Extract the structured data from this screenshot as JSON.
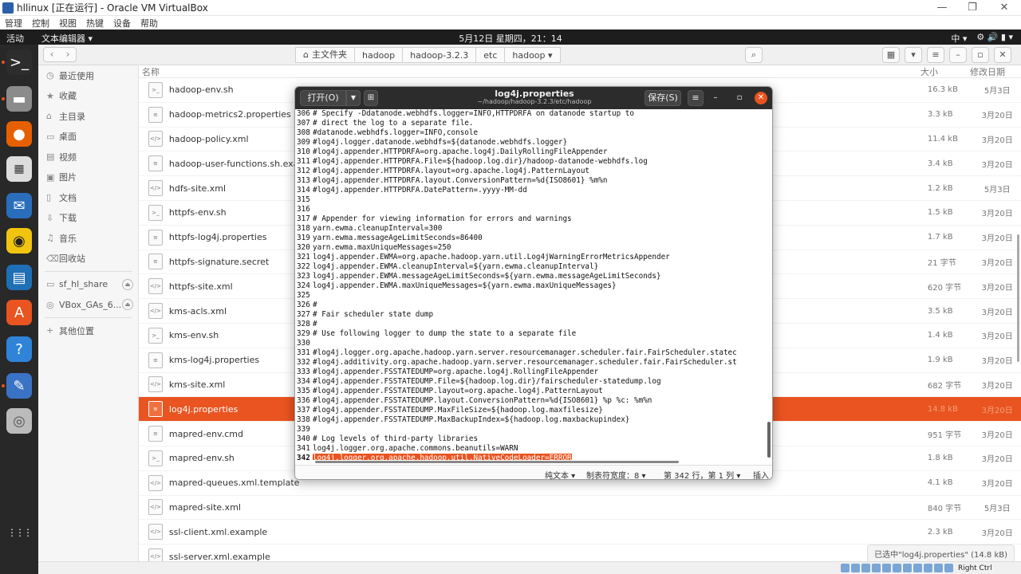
{
  "vbox": {
    "title": "hllinux [正在运行] - Oracle VM VirtualBox",
    "menu": [
      "管理",
      "控制",
      "视图",
      "热键",
      "设备",
      "帮助"
    ],
    "controls": {
      "minimize": "—",
      "restore": "❐",
      "close": "✕"
    },
    "host_key": "Right Ctrl"
  },
  "topbar": {
    "activities": "活动",
    "app_menu": "文本编辑器 ▾",
    "clock": "5月12日 星期四，21：14",
    "right": [
      "中 ▾",
      "⚙ 🔊 ▮ ▾"
    ]
  },
  "dock": {
    "apps": [
      {
        "name": "terminal-icon",
        "glyph": ">_",
        "bg": "#2d2d2d",
        "running": true
      },
      {
        "name": "files-icon",
        "glyph": "▬",
        "bg": "#8b8b8b",
        "running": true
      },
      {
        "name": "firefox-icon",
        "glyph": "●",
        "bg": "#e66000",
        "running": false
      },
      {
        "name": "calculator-icon",
        "glyph": "▦",
        "bg": "#ddd",
        "running": false
      },
      {
        "name": "thunderbird-icon",
        "glyph": "✉",
        "bg": "#2a6ebb",
        "running": false
      },
      {
        "name": "rhythmbox-icon",
        "glyph": "◉",
        "bg": "#f1c40f",
        "running": false
      },
      {
        "name": "writer-icon",
        "glyph": "▤",
        "bg": "#1f6fb5",
        "running": false
      },
      {
        "name": "software-icon",
        "glyph": "A",
        "bg": "#e95420",
        "running": false
      },
      {
        "name": "help-icon",
        "glyph": "?",
        "bg": "#2f84d7",
        "running": false
      },
      {
        "name": "text-editor-icon",
        "glyph": "✎",
        "bg": "#3b73c4",
        "running": true
      },
      {
        "name": "dvd-icon",
        "glyph": "◎",
        "bg": "#bbb",
        "running": false
      },
      {
        "name": "app-grid-icon",
        "glyph": "⋮⋮⋮",
        "bg": "#282828",
        "running": false
      }
    ]
  },
  "files": {
    "breadcrumb": [
      "主文件夹",
      "hadoop",
      "hadoop-3.2.3",
      "etc",
      "hadoop ▾"
    ],
    "sidebar": [
      {
        "icon": "◷",
        "label": "最近使用"
      },
      {
        "icon": "★",
        "label": "收藏"
      },
      {
        "icon": "⌂",
        "label": "主目录"
      },
      {
        "icon": "▭",
        "label": "桌面"
      },
      {
        "icon": "▤",
        "label": "视频"
      },
      {
        "icon": "▣",
        "label": "图片"
      },
      {
        "icon": "▯",
        "label": "文档"
      },
      {
        "icon": "⇩",
        "label": "下载"
      },
      {
        "icon": "♫",
        "label": "音乐"
      },
      {
        "icon": "⌫",
        "label": "回收站"
      },
      {
        "icon": "▭",
        "label": "sf_hl_share",
        "eject": true
      },
      {
        "icon": "◎",
        "label": "VBox_GAs_6...",
        "eject": true
      },
      {
        "icon": "+",
        "label": "其他位置"
      }
    ],
    "columns": {
      "name": "名称",
      "size": "大小",
      "modified": "修改日期"
    },
    "rows": [
      {
        "icon": ">_",
        "name": "hadoop-env.sh",
        "size": "16.3 kB",
        "date": "5月3日"
      },
      {
        "icon": "≡",
        "name": "hadoop-metrics2.properties",
        "size": "3.3 kB",
        "date": "3月20日"
      },
      {
        "icon": "</>",
        "name": "hadoop-policy.xml",
        "size": "11.4 kB",
        "date": "3月20日"
      },
      {
        "icon": "≡",
        "name": "hadoop-user-functions.sh.example",
        "size": "3.4 kB",
        "date": "3月20日"
      },
      {
        "icon": "</>",
        "name": "hdfs-site.xml",
        "size": "1.2 kB",
        "date": "5月3日"
      },
      {
        "icon": ">_",
        "name": "httpfs-env.sh",
        "size": "1.5 kB",
        "date": "3月20日"
      },
      {
        "icon": "≡",
        "name": "httpfs-log4j.properties",
        "size": "1.7 kB",
        "date": "3月20日"
      },
      {
        "icon": "≡",
        "name": "httpfs-signature.secret",
        "size": "21 字节",
        "date": "3月20日"
      },
      {
        "icon": "</>",
        "name": "httpfs-site.xml",
        "size": "620 字节",
        "date": "3月20日"
      },
      {
        "icon": "</>",
        "name": "kms-acls.xml",
        "size": "3.5 kB",
        "date": "3月20日"
      },
      {
        "icon": ">_",
        "name": "kms-env.sh",
        "size": "1.4 kB",
        "date": "3月20日"
      },
      {
        "icon": "≡",
        "name": "kms-log4j.properties",
        "size": "1.9 kB",
        "date": "3月20日"
      },
      {
        "icon": "</>",
        "name": "kms-site.xml",
        "size": "682 字节",
        "date": "3月20日"
      },
      {
        "icon": "≡",
        "name": "log4j.properties",
        "size": "14.8 kB",
        "date": "3月20日",
        "selected": true
      },
      {
        "icon": "≡",
        "name": "mapred-env.cmd",
        "size": "951 字节",
        "date": "3月20日"
      },
      {
        "icon": ">_",
        "name": "mapred-env.sh",
        "size": "1.8 kB",
        "date": "3月20日"
      },
      {
        "icon": "</>",
        "name": "mapred-queues.xml.template",
        "size": "4.1 kB",
        "date": "3月20日"
      },
      {
        "icon": "</>",
        "name": "mapred-site.xml",
        "size": "840 字节",
        "date": "5月3日"
      },
      {
        "icon": "</>",
        "name": "ssl-client.xml.example",
        "size": "2.3 kB",
        "date": "3月20日"
      },
      {
        "icon": "</>",
        "name": "ssl-server.xml.example",
        "size": "",
        "date": ""
      }
    ],
    "status": "已选中\"log4j.properties\" (14.8 kB)"
  },
  "editor": {
    "open_label": "打开(O)",
    "title": "log4j.properties",
    "path": "~/hadoop/hadoop-3.2.3/etc/hadoop",
    "save_label": "保存(S)",
    "lines": [
      {
        "n": "306",
        "t": "# Specify -Ddatanode.webhdfs.logger=INFO,HTTPDRFA on datanode startup to"
      },
      {
        "n": "307",
        "t": "# direct the log to a separate file."
      },
      {
        "n": "308",
        "t": "#datanode.webhdfs.logger=INFO,console"
      },
      {
        "n": "309",
        "t": "#log4j.logger.datanode.webhdfs=${datanode.webhdfs.logger}"
      },
      {
        "n": "310",
        "t": "#log4j.appender.HTTPDRFA=org.apache.log4j.DailyRollingFileAppender"
      },
      {
        "n": "311",
        "t": "#log4j.appender.HTTPDRFA.File=${hadoop.log.dir}/hadoop-datanode-webhdfs.log"
      },
      {
        "n": "312",
        "t": "#log4j.appender.HTTPDRFA.layout=org.apache.log4j.PatternLayout"
      },
      {
        "n": "313",
        "t": "#log4j.appender.HTTPDRFA.layout.ConversionPattern=%d{ISO8601} %m%n"
      },
      {
        "n": "314",
        "t": "#log4j.appender.HTTPDRFA.DatePattern=.yyyy-MM-dd"
      },
      {
        "n": "315",
        "t": ""
      },
      {
        "n": "316",
        "t": ""
      },
      {
        "n": "317",
        "t": "# Appender for viewing information for errors and warnings"
      },
      {
        "n": "318",
        "t": "yarn.ewma.cleanupInterval=300"
      },
      {
        "n": "319",
        "t": "yarn.ewma.messageAgeLimitSeconds=86400"
      },
      {
        "n": "320",
        "t": "yarn.ewma.maxUniqueMessages=250"
      },
      {
        "n": "321",
        "t": "log4j.appender.EWMA=org.apache.hadoop.yarn.util.Log4jWarningErrorMetricsAppender"
      },
      {
        "n": "322",
        "t": "log4j.appender.EWMA.cleanupInterval=${yarn.ewma.cleanupInterval}"
      },
      {
        "n": "323",
        "t": "log4j.appender.EWMA.messageAgeLimitSeconds=${yarn.ewma.messageAgeLimitSeconds}"
      },
      {
        "n": "324",
        "t": "log4j.appender.EWMA.maxUniqueMessages=${yarn.ewma.maxUniqueMessages}"
      },
      {
        "n": "325",
        "t": ""
      },
      {
        "n": "326",
        "t": "#"
      },
      {
        "n": "327",
        "t": "# Fair scheduler state dump"
      },
      {
        "n": "328",
        "t": "#"
      },
      {
        "n": "329",
        "t": "# Use following logger to dump the state to a separate file"
      },
      {
        "n": "330",
        "t": ""
      },
      {
        "n": "331",
        "t": "#log4j.logger.org.apache.hadoop.yarn.server.resourcemanager.scheduler.fair.FairScheduler.statec"
      },
      {
        "n": "332",
        "t": "#log4j.additivity.org.apache.hadoop.yarn.server.resourcemanager.scheduler.fair.FairScheduler.st"
      },
      {
        "n": "333",
        "t": "#log4j.appender.FSSTATEDUMP=org.apache.log4j.RollingFileAppender"
      },
      {
        "n": "334",
        "t": "#log4j.appender.FSSTATEDUMP.File=${hadoop.log.dir}/fairscheduler-statedump.log"
      },
      {
        "n": "335",
        "t": "#log4j.appender.FSSTATEDUMP.layout=org.apache.log4j.PatternLayout"
      },
      {
        "n": "336",
        "t": "#log4j.appender.FSSTATEDUMP.layout.ConversionPattern=%d{ISO8601} %p %c: %m%n"
      },
      {
        "n": "337",
        "t": "#log4j.appender.FSSTATEDUMP.MaxFileSize=${hadoop.log.maxfilesize}"
      },
      {
        "n": "338",
        "t": "#log4j.appender.FSSTATEDUMP.MaxBackupIndex=${hadoop.log.maxbackupindex}"
      },
      {
        "n": "339",
        "t": ""
      },
      {
        "n": "340",
        "t": "# Log levels of third-party libraries"
      },
      {
        "n": "341",
        "t": "log4j.logger.org.apache.commons.beanutils=WARN"
      },
      {
        "n": "342",
        "t": "log4j.logger.org.apache.hadoop.util.NativeCodeLoader=ERROR",
        "current": true
      }
    ],
    "status": {
      "syntax": "纯文本 ▾",
      "tab_width": "制表符宽度：8 ▾",
      "position": "第 342 行，第 1 列 ▾",
      "mode": "插入"
    }
  }
}
